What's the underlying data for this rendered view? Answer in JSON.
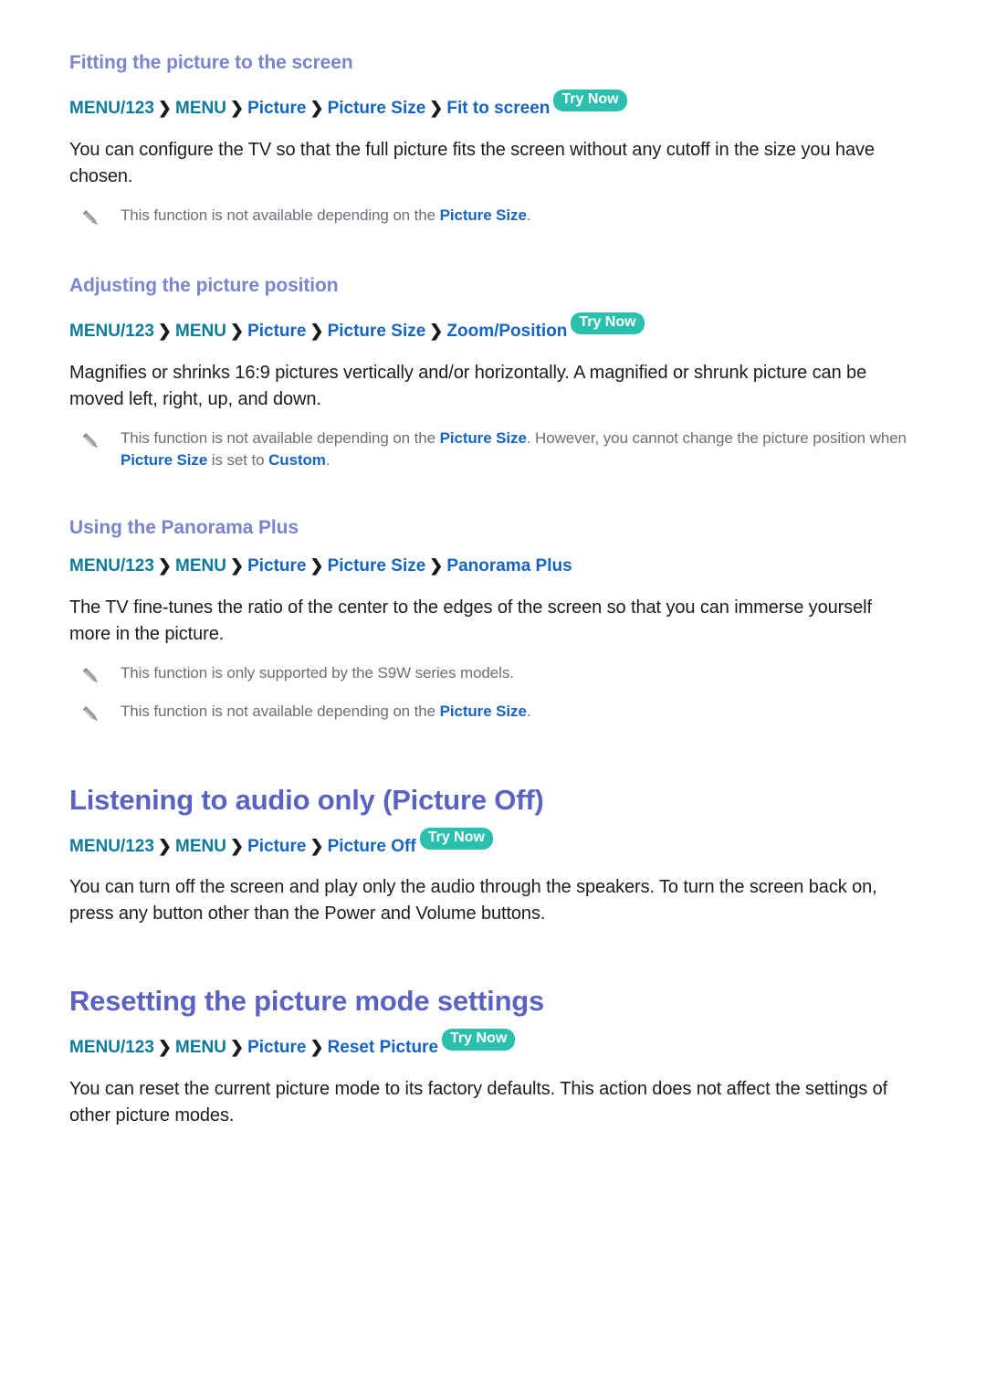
{
  "sections": [
    {
      "id": "fitting",
      "heading": "Fitting the picture to the screen",
      "path": {
        "menu123": "MENU/123",
        "menu": "MENU",
        "items": [
          "Picture",
          "Picture Size",
          "Fit to screen"
        ],
        "badge": "Try Now"
      },
      "body": "You can configure the TV so that the full picture fits the screen without any cutoff in the size you have chosen.",
      "notes": [
        {
          "icon": "pencil-note-icon",
          "pre": "This function is not available depending on the ",
          "link": "Picture Size",
          "post": "."
        }
      ]
    },
    {
      "id": "adjusting",
      "heading": "Adjusting the picture position",
      "path": {
        "menu123": "MENU/123",
        "menu": "MENU",
        "items": [
          "Picture",
          "Picture Size",
          "Zoom/Position"
        ],
        "badge": "Try Now"
      },
      "body": "Magnifies or shrinks 16:9 pictures vertically and/or horizontally. A magnified or shrunk picture can be moved left, right, up, and down.",
      "notes": [
        {
          "icon": "pencil-note-icon",
          "pre": "This function is not available depending on the ",
          "link": "Picture Size",
          "mid": ". However, you cannot change the picture position when ",
          "link2": "Picture Size",
          "mid2": " is set to ",
          "link3": "Custom",
          "post": "."
        }
      ]
    },
    {
      "id": "panorama",
      "heading": "Using the Panorama Plus",
      "path": {
        "menu123": "MENU/123",
        "menu": "MENU",
        "items": [
          "Picture",
          "Picture Size",
          "Panorama Plus"
        ],
        "badge": ""
      },
      "body": "The TV fine-tunes the ratio of the center to the edges of the screen so that you can immerse yourself more in the picture.",
      "notes": [
        {
          "icon": "pencil-note-icon",
          "pre": "This function is only supported by the S9W series models.",
          "link": "",
          "post": ""
        },
        {
          "icon": "pencil-note-icon",
          "pre": "This function is not available depending on the ",
          "link": "Picture Size",
          "post": "."
        }
      ]
    },
    {
      "id": "picture-off",
      "heading": "Listening to audio only (Picture Off)",
      "path": {
        "menu123": "MENU/123",
        "menu": "MENU",
        "items": [
          "Picture",
          "Picture Off"
        ],
        "badge": "Try Now"
      },
      "body": "You can turn off the screen and play only the audio through the speakers. To turn the screen back on, press any button other than the Power and Volume buttons.",
      "notes": []
    },
    {
      "id": "reset",
      "heading": "Resetting the picture mode settings",
      "path": {
        "menu123": "MENU/123",
        "menu": "MENU",
        "items": [
          "Picture",
          "Reset Picture"
        ],
        "badge": "Try Now"
      },
      "body": "You can reset the current picture mode to its factory defaults. This action does not affect the settings of other picture modes.",
      "notes": []
    }
  ],
  "colors": {
    "heading_major": "#5b63c1",
    "heading_minor": "#7c84ca",
    "menu_teal": "#0d7b99",
    "menu_item_blue": "#1565c0",
    "badge_bg": "#2bbfae",
    "body_text": "#1c1c1c",
    "note_text": "#6b6f76",
    "page_bg": "#ffffff"
  },
  "chevron_glyph": "❯"
}
